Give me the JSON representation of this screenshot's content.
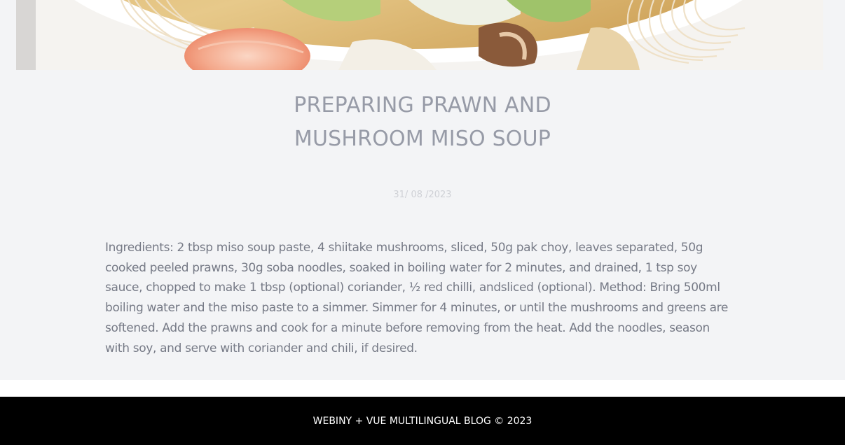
{
  "article": {
    "title_line1": "PREPARING PRAWN AND",
    "title_line2": "MUSHROOM MISO SOUP",
    "date": "31/ 08 /2023",
    "body": "Ingredients: 2 tbsp miso soup paste, 4 shiitake mushrooms, sliced, 50g pak choy, leaves separated, 50g cooked peeled prawns, 30g soba noodles, soaked in boiling water for 2 minutes, and drained, 1 tsp soy sauce, chopped to make 1 tbsp (optional) coriander, ½ red chilli, andsliced (optional). Method: Bring 500ml boiling water and the miso paste to a simmer. Simmer for 4 minutes, or until the mushrooms and greens are softened. Add the prawns and cook for a minute before removing from the heat. Add the noodles, season with soy, and serve with coriander and chili, if desired."
  },
  "footer": {
    "text": "WEBINY + VUE MULTILINGUAL BLOG © 2023"
  },
  "colors": {
    "article_background": "#f3f4f6",
    "title": "#979ba7",
    "date": "#cfd1d6",
    "body": "#767a86",
    "footer_background": "#000000",
    "footer_text": "#ffffff"
  }
}
